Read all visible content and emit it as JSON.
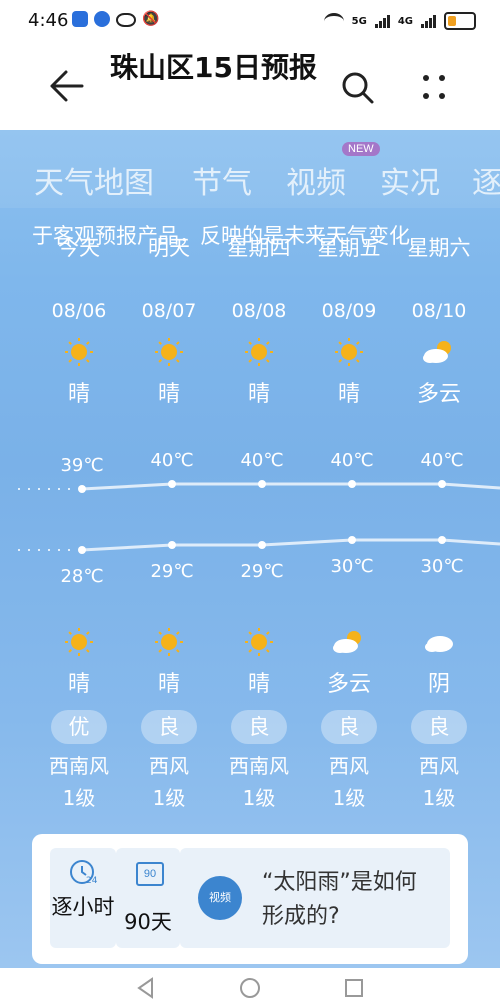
{
  "status": {
    "time": "4:46",
    "net1": "5G",
    "net2": "4G"
  },
  "header": {
    "title": "珠山区15日预报"
  },
  "tabs": [
    {
      "label": "天气地图"
    },
    {
      "label": "节气"
    },
    {
      "label": "视频",
      "badge": "NEW"
    },
    {
      "label": "实况"
    },
    {
      "label": "逐"
    }
  ],
  "notice": "于客观预报产品，反映的是未来天气变化",
  "days": [
    {
      "name": "今天",
      "date": "08/06",
      "day_weather": "晴",
      "day_icon": "sun-icon",
      "high": "39℃",
      "low": "28℃",
      "night_weather": "晴",
      "night_icon": "sun-icon",
      "aqi": "优",
      "wind_dir": "西南风",
      "wind_level": "1级"
    },
    {
      "name": "明天",
      "date": "08/07",
      "day_weather": "晴",
      "day_icon": "sun-icon",
      "high": "40℃",
      "low": "29℃",
      "night_weather": "晴",
      "night_icon": "sun-icon",
      "aqi": "良",
      "wind_dir": "西风",
      "wind_level": "1级"
    },
    {
      "name": "星期四",
      "date": "08/08",
      "day_weather": "晴",
      "day_icon": "sun-icon",
      "high": "40℃",
      "low": "29℃",
      "night_weather": "晴",
      "night_icon": "sun-icon",
      "aqi": "良",
      "wind_dir": "西南风",
      "wind_level": "1级"
    },
    {
      "name": "星期五",
      "date": "08/09",
      "day_weather": "晴",
      "day_icon": "sun-icon",
      "high": "40℃",
      "low": "30℃",
      "night_weather": "多云",
      "night_icon": "partly-cloudy-icon",
      "aqi": "良",
      "wind_dir": "西风",
      "wind_level": "1级"
    },
    {
      "name": "星期六",
      "date": "08/10",
      "day_weather": "多云",
      "day_icon": "partly-cloudy-icon",
      "high": "40℃",
      "low": "30℃",
      "night_weather": "阴",
      "night_icon": "cloud-icon",
      "aqi": "良",
      "wind_dir": "西风",
      "wind_level": "1级"
    }
  ],
  "bottom": {
    "hourly": {
      "icon_number": "24",
      "label": "逐小时"
    },
    "ninety": {
      "icon_number": "90",
      "label": "90天"
    },
    "video": {
      "icon_label": "视频",
      "title": "“太阳雨”是如何形成的?"
    }
  },
  "colors": {
    "accent": "#3c85cf",
    "sun": "#f5b21a",
    "sky": "#7fb7ec"
  }
}
